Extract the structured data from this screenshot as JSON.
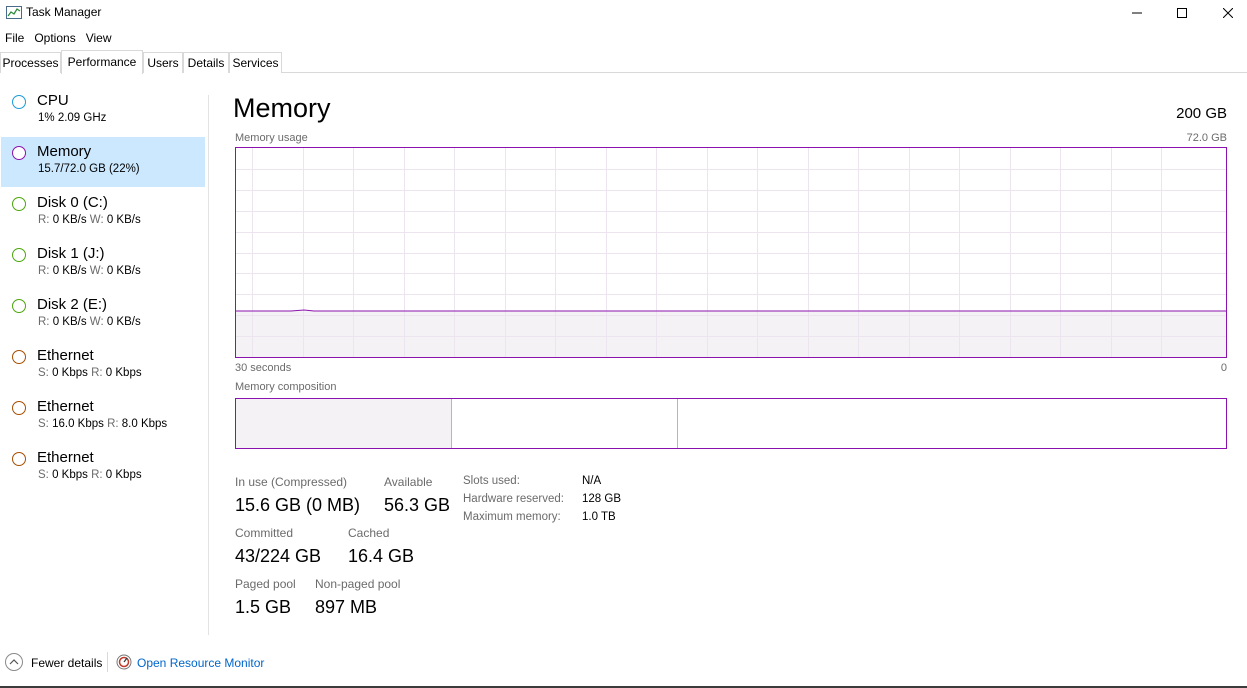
{
  "window": {
    "title": "Task Manager",
    "icon": "task-manager-icon"
  },
  "menu": [
    "File",
    "Options",
    "View"
  ],
  "tabs": [
    {
      "label": "Processes",
      "active": false
    },
    {
      "label": "Performance",
      "active": true
    },
    {
      "label": "Users",
      "active": false
    },
    {
      "label": "Details",
      "active": false
    },
    {
      "label": "Services",
      "active": false
    }
  ],
  "sidebar": {
    "items": [
      {
        "title": "CPU",
        "sub1": "1%  2.09 GHz",
        "color": "#1a9bd8",
        "selected": false
      },
      {
        "title": "Memory",
        "sub1": "15.7/72.0 GB (22%)",
        "color": "#8b12ae",
        "selected": true
      },
      {
        "title": "Disk 0 (C:)",
        "k1": "R:",
        "v1": "0 KB/s",
        "k2": "W:",
        "v2": "0 KB/s",
        "color": "#4da60c",
        "selected": false
      },
      {
        "title": "Disk 1 (J:)",
        "k1": "R:",
        "v1": "0 KB/s",
        "k2": "W:",
        "v2": "0 KB/s",
        "color": "#4da60c",
        "selected": false
      },
      {
        "title": "Disk 2 (E:)",
        "k1": "R:",
        "v1": "0 KB/s",
        "k2": "W:",
        "v2": "0 KB/s",
        "color": "#4da60c",
        "selected": false
      },
      {
        "title": "Ethernet",
        "k1": "S:",
        "v1": "0 Kbps",
        "k2": "R:",
        "v2": "0 Kbps",
        "color": "#a74f01",
        "selected": false
      },
      {
        "title": "Ethernet",
        "k1": "S:",
        "v1": "16.0 Kbps",
        "k2": "R:",
        "v2": "8.0 Kbps",
        "color": "#a74f01",
        "selected": false
      },
      {
        "title": "Ethernet",
        "k1": "S:",
        "v1": "0 Kbps",
        "k2": "R:",
        "v2": "0 Kbps",
        "color": "#a74f01",
        "selected": false
      }
    ]
  },
  "main": {
    "heading": "Memory",
    "total": "200 GB",
    "usage_label": "Memory usage",
    "usage_max": "72.0 GB",
    "time_left": "30 seconds",
    "time_right": "0",
    "composition_label": "Memory composition",
    "usage_fraction": 0.22,
    "stats": {
      "in_use_label": "In use (Compressed)",
      "in_use_value": "15.6 GB (0 MB)",
      "available_label": "Available",
      "available_value": "56.3 GB",
      "committed_label": "Committed",
      "committed_value": "43/224 GB",
      "cached_label": "Cached",
      "cached_value": "16.4 GB",
      "paged_label": "Paged pool",
      "paged_value": "1.5 GB",
      "nonpaged_label": "Non-paged pool",
      "nonpaged_value": "897 MB"
    },
    "details": {
      "slots_label": "Slots used:",
      "slots_value": "N/A",
      "hw_label": "Hardware reserved:",
      "hw_value": "128 GB",
      "max_label": "Maximum memory:",
      "max_value": "1.0 TB"
    },
    "colors": {
      "accent": "#8b12ae",
      "fill": "#f4f2f4",
      "grid": "#ece5ef"
    }
  },
  "footer": {
    "fewer_details": "Fewer details",
    "resource_monitor": "Open Resource Monitor"
  }
}
